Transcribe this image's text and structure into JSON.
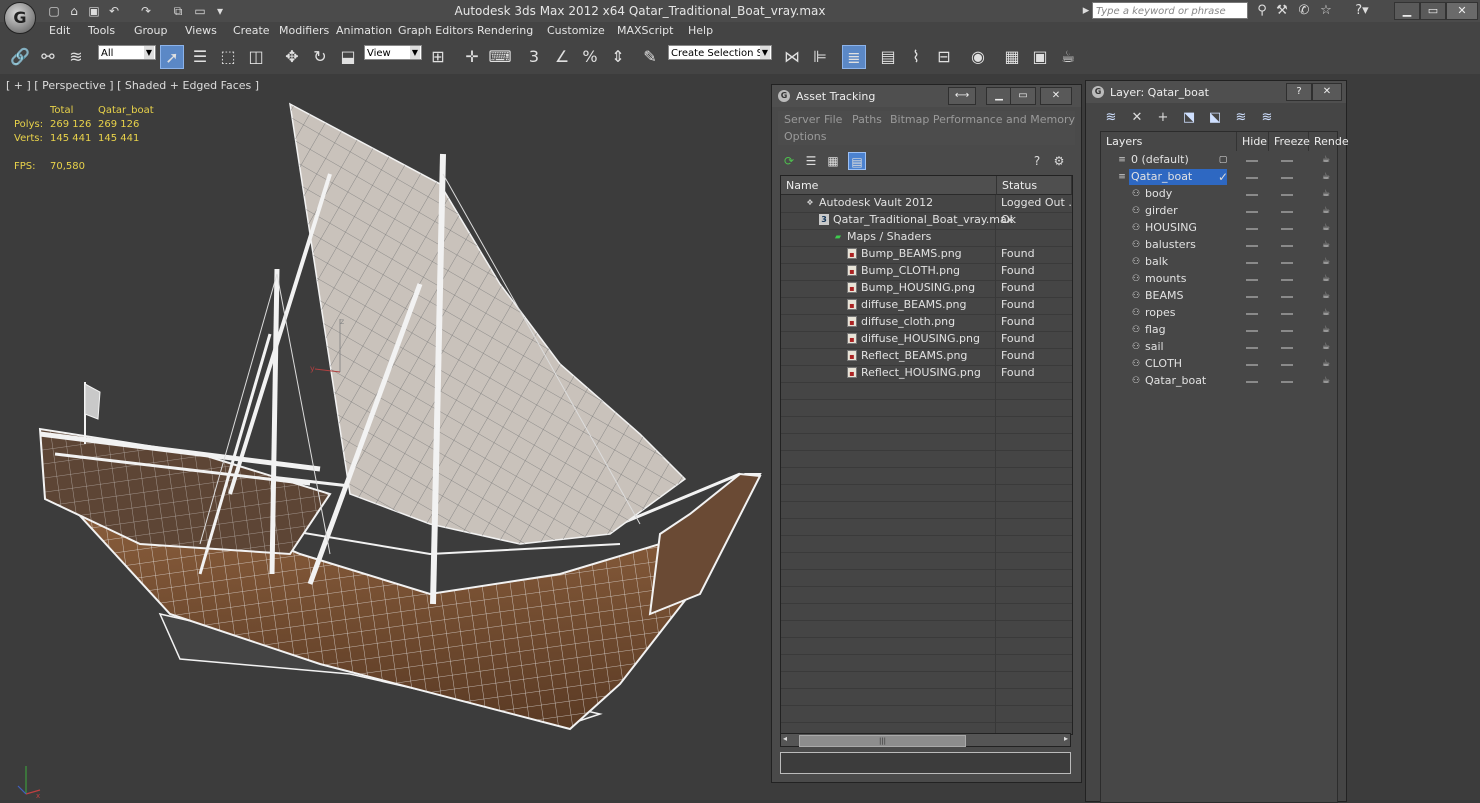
{
  "app": {
    "logo_glyph": "G",
    "title": "Autodesk 3ds Max  2012 x64      Qatar_Traditional_Boat_vray.max",
    "search_placeholder": "Type a keyword or phrase"
  },
  "menu": [
    "Edit",
    "Tools",
    "Group",
    "Views",
    "Create",
    "Modifiers",
    "Animation",
    "Graph Editors",
    "Rendering",
    "Customize",
    "MAXScript",
    "Help"
  ],
  "toolbar": {
    "selection_filter": "All",
    "ref_coord": "View",
    "named_selection": "Create Selection Se"
  },
  "viewport": {
    "label": "[ + ] [ Perspective ] [ Shaded + Edged Faces ]",
    "stats": {
      "header_total": "Total",
      "header_object": "Qatar_boat",
      "polys_label": "Polys:",
      "polys_total": "269 126",
      "polys_object": "269 126",
      "verts_label": "Verts:",
      "verts_total": "145 441",
      "verts_object": "145 441",
      "fps_label": "FPS:",
      "fps_value": "70,580"
    },
    "axis_z": "z",
    "axis_y": "y",
    "axis_x": "x"
  },
  "asset_tracking": {
    "title": "Asset Tracking",
    "menu_row1": [
      "Server",
      "File",
      "Paths",
      "Bitmap Performance and Memory"
    ],
    "menu_row2": [
      "Options"
    ],
    "columns": {
      "name": "Name",
      "status": "Status"
    },
    "rows": [
      {
        "name": "Autodesk Vault 2012",
        "status": "Logged Out ...",
        "icon": "vault-icon",
        "indent": 1
      },
      {
        "name": "Qatar_Traditional_Boat_vray.max",
        "status": "Ok",
        "icon": "max-file-icon",
        "indent": 2
      },
      {
        "name": "Maps / Shaders",
        "status": "",
        "icon": "folder-icon",
        "indent": 3
      },
      {
        "name": "Bump_BEAMS.png",
        "status": "Found",
        "icon": "image-file-icon",
        "indent": 4
      },
      {
        "name": "Bump_CLOTH.png",
        "status": "Found",
        "icon": "image-file-icon",
        "indent": 4
      },
      {
        "name": "Bump_HOUSING.png",
        "status": "Found",
        "icon": "image-file-icon",
        "indent": 4
      },
      {
        "name": "diffuse_BEAMS.png",
        "status": "Found",
        "icon": "image-file-icon",
        "indent": 4
      },
      {
        "name": "diffuse_cloth.png",
        "status": "Found",
        "icon": "image-file-icon",
        "indent": 4
      },
      {
        "name": "diffuse_HOUSING.png",
        "status": "Found",
        "icon": "image-file-icon",
        "indent": 4
      },
      {
        "name": "Reflect_BEAMS.png",
        "status": "Found",
        "icon": "image-file-icon",
        "indent": 4
      },
      {
        "name": "Reflect_HOUSING.png",
        "status": "Found",
        "icon": "image-file-icon",
        "indent": 4
      }
    ],
    "scroll_grip": "|||"
  },
  "layer_manager": {
    "title": "Layer: Qatar_boat",
    "columns": {
      "layers": "Layers",
      "hide": "Hide",
      "freeze": "Freeze",
      "render": "Rende"
    },
    "layers": [
      {
        "name": "0 (default)",
        "level": 0,
        "selected": false,
        "active_mark": "box"
      },
      {
        "name": "Qatar_boat",
        "level": 0,
        "selected": true,
        "active_mark": "check"
      },
      {
        "name": "body",
        "level": 1
      },
      {
        "name": "girder",
        "level": 1
      },
      {
        "name": "HOUSING",
        "level": 1
      },
      {
        "name": "balusters",
        "level": 1
      },
      {
        "name": "balk",
        "level": 1
      },
      {
        "name": "mounts",
        "level": 1
      },
      {
        "name": "BEAMS",
        "level": 1
      },
      {
        "name": "ropes",
        "level": 1
      },
      {
        "name": "flag",
        "level": 1
      },
      {
        "name": "sail",
        "level": 1
      },
      {
        "name": "CLOTH",
        "level": 1
      },
      {
        "name": "Qatar_boat",
        "level": 1
      }
    ]
  },
  "colors": {
    "accent": "#2e68c2",
    "stats_yellow": "#e8d24a",
    "hull_brown": "#8a5a3a",
    "wire_white": "#f2f2f2"
  }
}
